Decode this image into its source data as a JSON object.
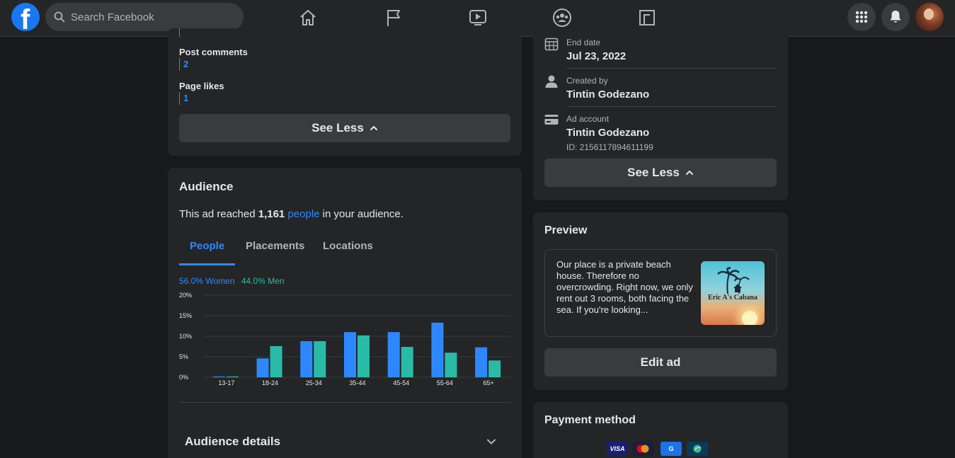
{
  "topbar": {
    "search_placeholder": "Search Facebook",
    "logo_letter": "f"
  },
  "engagement": {
    "metrics": [
      {
        "label": "Post comments",
        "value": "2"
      },
      {
        "label": "Page likes",
        "value": "1"
      }
    ],
    "see_less": "See Less"
  },
  "audience": {
    "title": "Audience",
    "reach_prefix": "This ad reached ",
    "reach_count": "1,161",
    "reach_link": "people",
    "reach_suffix": " in your audience.",
    "tabs": [
      "People",
      "Placements",
      "Locations"
    ],
    "active_tab": "People",
    "legend_women": "56.0% Women",
    "legend_men": "44.0% Men",
    "details_label": "Audience details"
  },
  "chart_data": {
    "type": "bar",
    "categories": [
      "13-17",
      "18-24",
      "25-34",
      "35-44",
      "45-54",
      "55-64",
      "65+"
    ],
    "series": [
      {
        "name": "Women",
        "color": "#2d88ff",
        "values": [
          0.2,
          4.6,
          8.8,
          11.0,
          11.0,
          13.3,
          7.3
        ]
      },
      {
        "name": "Men",
        "color": "#2abba7",
        "values": [
          0.2,
          7.6,
          8.8,
          10.2,
          7.4,
          6.0,
          4.1
        ]
      }
    ],
    "y_ticks": [
      "20%",
      "15%",
      "10%",
      "5%",
      "0%"
    ],
    "ylim": [
      0,
      20
    ],
    "grid": true
  },
  "ad_details": {
    "rows": [
      {
        "icon": "calendar-icon",
        "label": "End date",
        "value": "Jul 23, 2022"
      },
      {
        "icon": "person-icon",
        "label": "Created by",
        "value": "Tintin Godezano"
      },
      {
        "icon": "credit-card-icon",
        "label": "Ad account",
        "value": "Tintin Godezano",
        "sub": "ID: 2156117894611199"
      }
    ],
    "see_less": "See Less"
  },
  "preview": {
    "title": "Preview",
    "ad_text": "Our place is a private beach house. Therefore no overcrowding. Right now, we only rent out 3 rooms, both facing the sea. If you're looking...",
    "image_brand": "Eric A's Cabana",
    "edit_button": "Edit ad"
  },
  "payment": {
    "title": "Payment method",
    "cards": [
      {
        "name": "visa",
        "label": "VISA",
        "color": "#1a1f71"
      },
      {
        "name": "mastercard",
        "label": "",
        "color": "#1a1f3a"
      },
      {
        "name": "gpay",
        "label": "G",
        "color": "#1a73e8"
      },
      {
        "name": "other",
        "label": "",
        "color": "#0b3a5a"
      }
    ]
  }
}
